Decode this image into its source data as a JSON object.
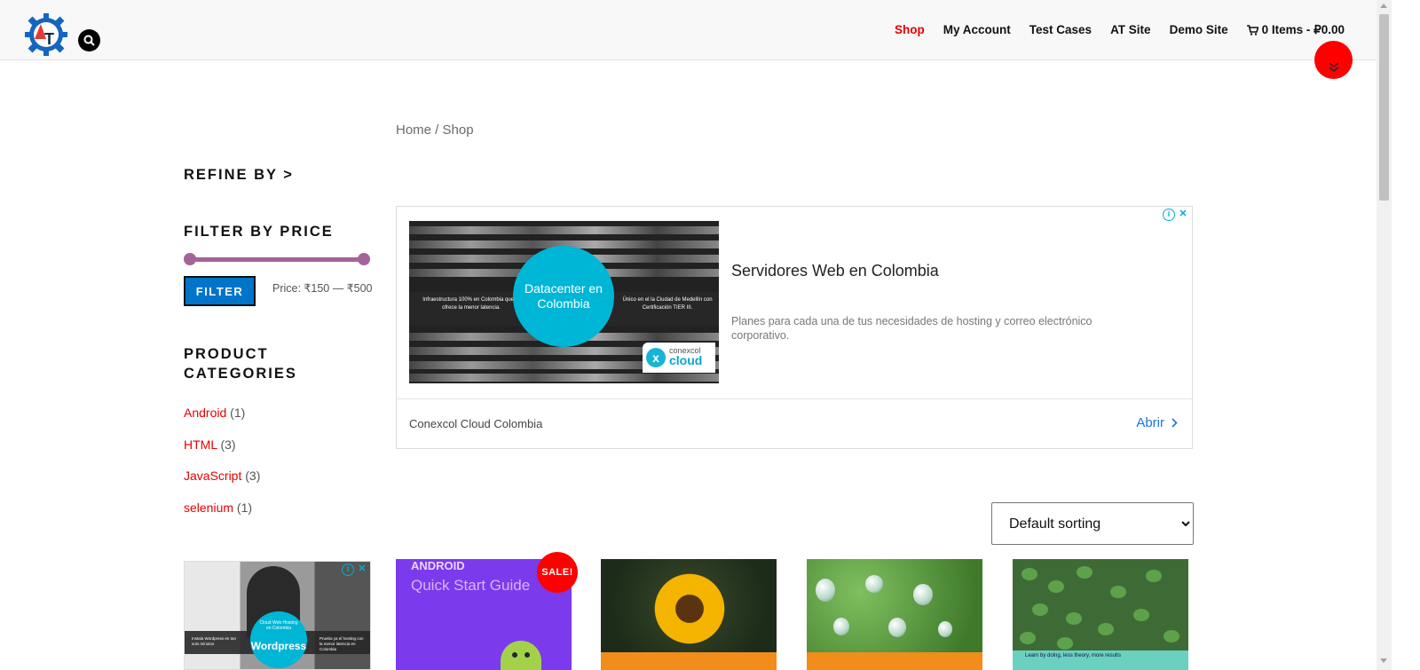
{
  "header": {
    "logo_text": "AT",
    "nav": [
      {
        "label": "Shop",
        "active": true
      },
      {
        "label": "My Account",
        "active": false
      },
      {
        "label": "Test Cases",
        "active": false
      },
      {
        "label": "AT Site",
        "active": false
      },
      {
        "label": "Demo Site",
        "active": false
      }
    ],
    "cart_label": "0 Items - ₽0.00"
  },
  "breadcrumb": "Home / Shop",
  "sidebar": {
    "refine_heading": "REFINE BY >",
    "filter_heading": "FILTER BY PRICE",
    "filter_button": "FILTER",
    "price_label": "Price: ₹150 — ₹500",
    "price_range": {
      "min": 150,
      "max": 500
    },
    "categories_heading": "PRODUCT CATEGORIES",
    "categories": [
      {
        "name": "Android",
        "count": "(1)"
      },
      {
        "name": "HTML",
        "count": "(3)"
      },
      {
        "name": "JavaScript",
        "count": "(3)"
      },
      {
        "name": "selenium",
        "count": "(1)"
      }
    ]
  },
  "ad": {
    "image_circle_text": "Datacenter en Colombia",
    "image_left_text": "Infraestructura 100% en Colombia que te ofrece la menor latencia.",
    "image_right_text": "Único en el la Ciudad de Medellín con Certificación TIER III.",
    "brand_small": "conexcol",
    "brand_big": "cloud",
    "title": "Servidores Web en Colombia",
    "description": "Planes para cada una de tus necesidades de hosting y correo electrónico corporativo.",
    "advertiser": "Conexcol Cloud Colombia",
    "open_label": "Abrir"
  },
  "sorting": {
    "selected": "Default sorting",
    "options": [
      "Default sorting"
    ]
  },
  "products": {
    "p1_line1": "ANDROID",
    "p1_line2": "Quick Start Guide",
    "sale_badge": "SALE!",
    "p4_caption": "Learn by doing, less theory, more results"
  },
  "side_ad": {
    "circle_text": "Wordpress",
    "small_top": "Cloud Web Hosting en Colombia",
    "small_left": "Instala Wordpress en tan solo minutos",
    "small_right": "Prueba ya el hosting con la menor latencia en Colombia"
  },
  "colors": {
    "accent_red": "#e50000",
    "filter_blue": "#0074c8",
    "slider_purple": "#a46497",
    "ad_cyan": "#00b6d6"
  }
}
